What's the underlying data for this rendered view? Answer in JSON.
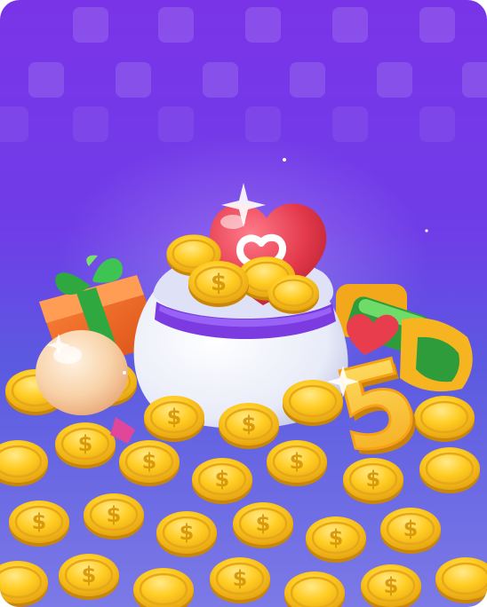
{
  "scene": {
    "name": "treasure-reward-scene",
    "number_badge": "5",
    "coin_symbol": "$",
    "palette": {
      "background_top": "#7a34e8",
      "background_bottom": "#7c7ae6",
      "coin_gold": "#f6c21c",
      "coin_rim": "#d99a0c",
      "heart_red": "#e23a4a",
      "gift_orange": "#ef6a24",
      "ribbon_green": "#34b24a",
      "bag_white": "#eef0fb",
      "bag_band": "#7b3be0",
      "egg_peach": "#f7d4ad"
    },
    "icons": [
      "coin-pile",
      "money-bag",
      "heart",
      "gift-box",
      "egg",
      "number-five",
      "green-bar",
      "sparkle"
    ]
  }
}
